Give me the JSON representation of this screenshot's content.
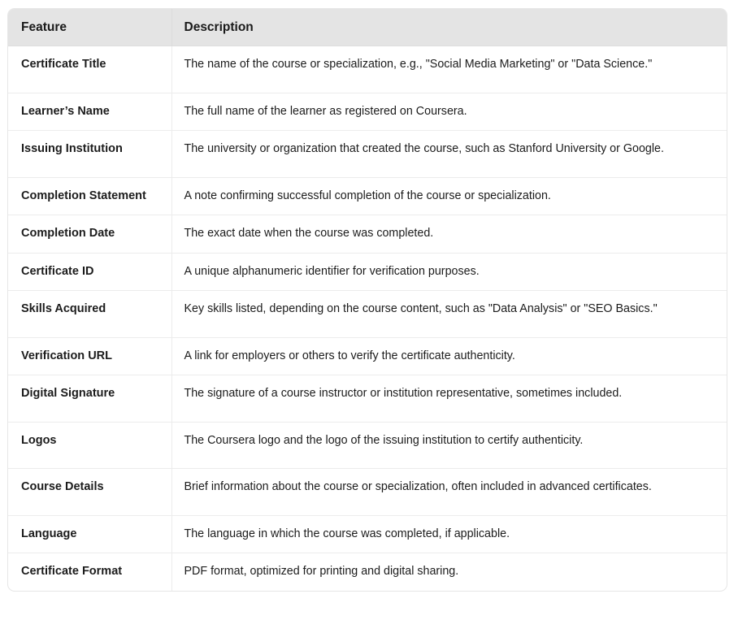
{
  "table": {
    "columns": [
      {
        "key": "feature",
        "label": "Feature"
      },
      {
        "key": "description",
        "label": "Description"
      }
    ],
    "header_background": "#e4e4e4",
    "border_color": "#ececec",
    "rows": [
      {
        "feature": "Certificate Title",
        "description": "The name of the course or specialization, e.g., \"Social Media Marketing\" or \"Data Science.\""
      },
      {
        "feature": "Learner’s Name",
        "description": "The full name of the learner as registered on Coursera."
      },
      {
        "feature": "Issuing Institution",
        "description": "The university or organization that created the course, such as Stanford University or Google."
      },
      {
        "feature": "Completion Statement",
        "description": "A note confirming successful completion of the course or specialization."
      },
      {
        "feature": "Completion Date",
        "description": "The exact date when the course was completed."
      },
      {
        "feature": "Certificate ID",
        "description": "A unique alphanumeric identifier for verification purposes."
      },
      {
        "feature": "Skills Acquired",
        "description": "Key skills listed, depending on the course content, such as \"Data Analysis\" or \"SEO Basics.\""
      },
      {
        "feature": "Verification URL",
        "description": "A link for employers or others to verify the certificate authenticity."
      },
      {
        "feature": "Digital Signature",
        "description": "The signature of a course instructor or institution representative, sometimes included."
      },
      {
        "feature": "Logos",
        "description": "The Coursera logo and the logo of the issuing institution to certify authenticity."
      },
      {
        "feature": "Course Details",
        "description": "Brief information about the course or specialization, often included in advanced certificates."
      },
      {
        "feature": "Language",
        "description": "The language in which the course was completed, if applicable."
      },
      {
        "feature": "Certificate Format",
        "description": "PDF format, optimized for printing and digital sharing."
      }
    ]
  }
}
